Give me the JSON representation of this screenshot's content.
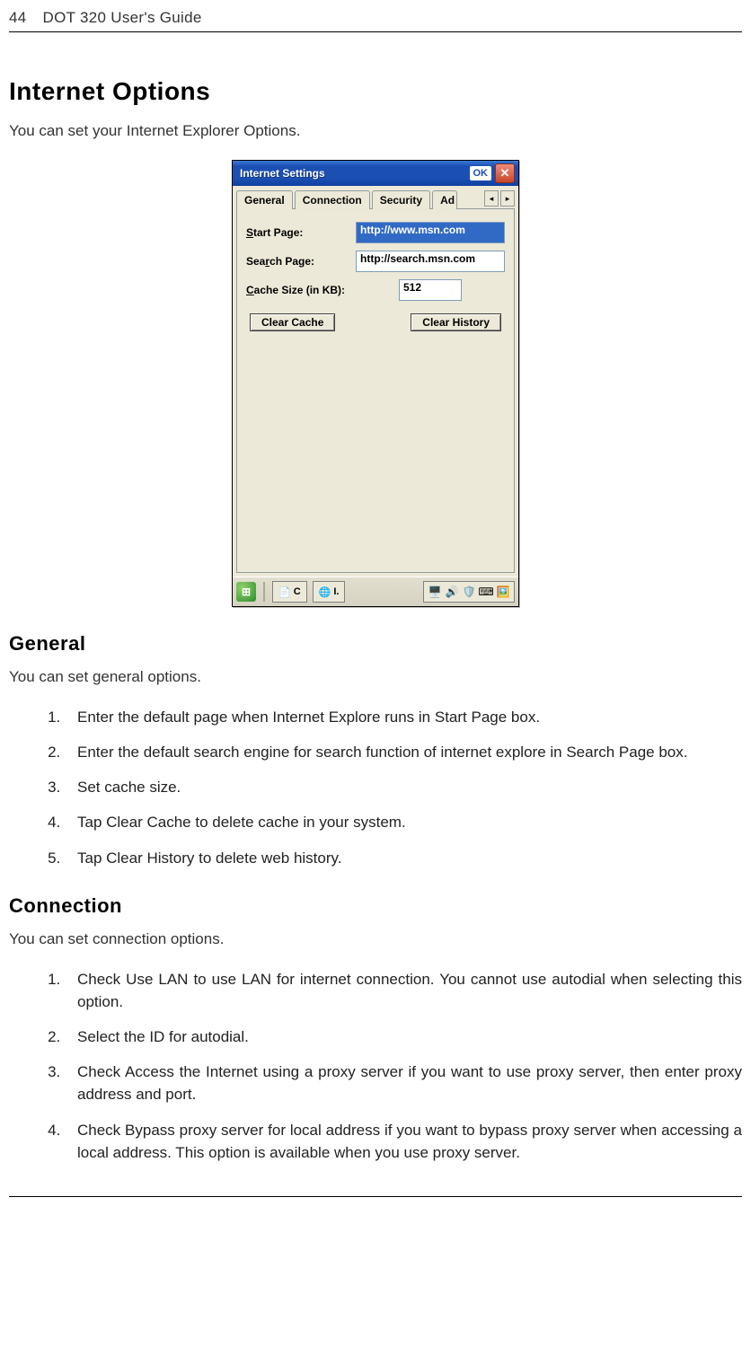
{
  "header": {
    "page_number": "44",
    "title": "DOT 320 User's Guide"
  },
  "h1": "Internet Options",
  "intro": "You can set your Internet Explorer Options.",
  "screenshot": {
    "title": "Internet Settings",
    "ok": "OK",
    "tabs": {
      "t1": "General",
      "t2": "Connection",
      "t3": "Security",
      "t4": "Ad"
    },
    "labels": {
      "start_prefix": "S",
      "start_rest": "tart Page:",
      "search_prefix": "Sea",
      "search_u": "r",
      "search_rest": "ch Page:",
      "cache_u": "C",
      "cache_rest": "ache Size (in KB):"
    },
    "values": {
      "start_page": "http://www.msn.com",
      "search_page": "http://search.msn.com",
      "cache_size": "512"
    },
    "buttons": {
      "clear_cache": "Clear Cache",
      "clear_history": "Clear History"
    },
    "taskbar": {
      "task_c": "C",
      "task_i": "I."
    }
  },
  "general": {
    "heading": "General",
    "intro": "You can set general options.",
    "items": {
      "i1": "Enter the default page when Internet Explore runs in Start Page box.",
      "i2": "Enter the default search engine for search function of internet explore in Search Page box.",
      "i3": "Set cache size.",
      "i4": "Tap Clear Cache to delete cache in your system.",
      "i5": "Tap Clear History to delete web history."
    }
  },
  "connection": {
    "heading": "Connection",
    "intro": "You can set connection options.",
    "items": {
      "i1": "Check Use LAN to use LAN for internet connection. You cannot use autodial when selecting this option.",
      "i2": "Select the ID for autodial.",
      "i3": "Check Access the Internet using a proxy server if you want to use proxy server, then enter proxy address and port.",
      "i4": "Check Bypass proxy server for local address if you want to bypass proxy server when accessing a local address. This option is available when you use proxy server."
    }
  }
}
